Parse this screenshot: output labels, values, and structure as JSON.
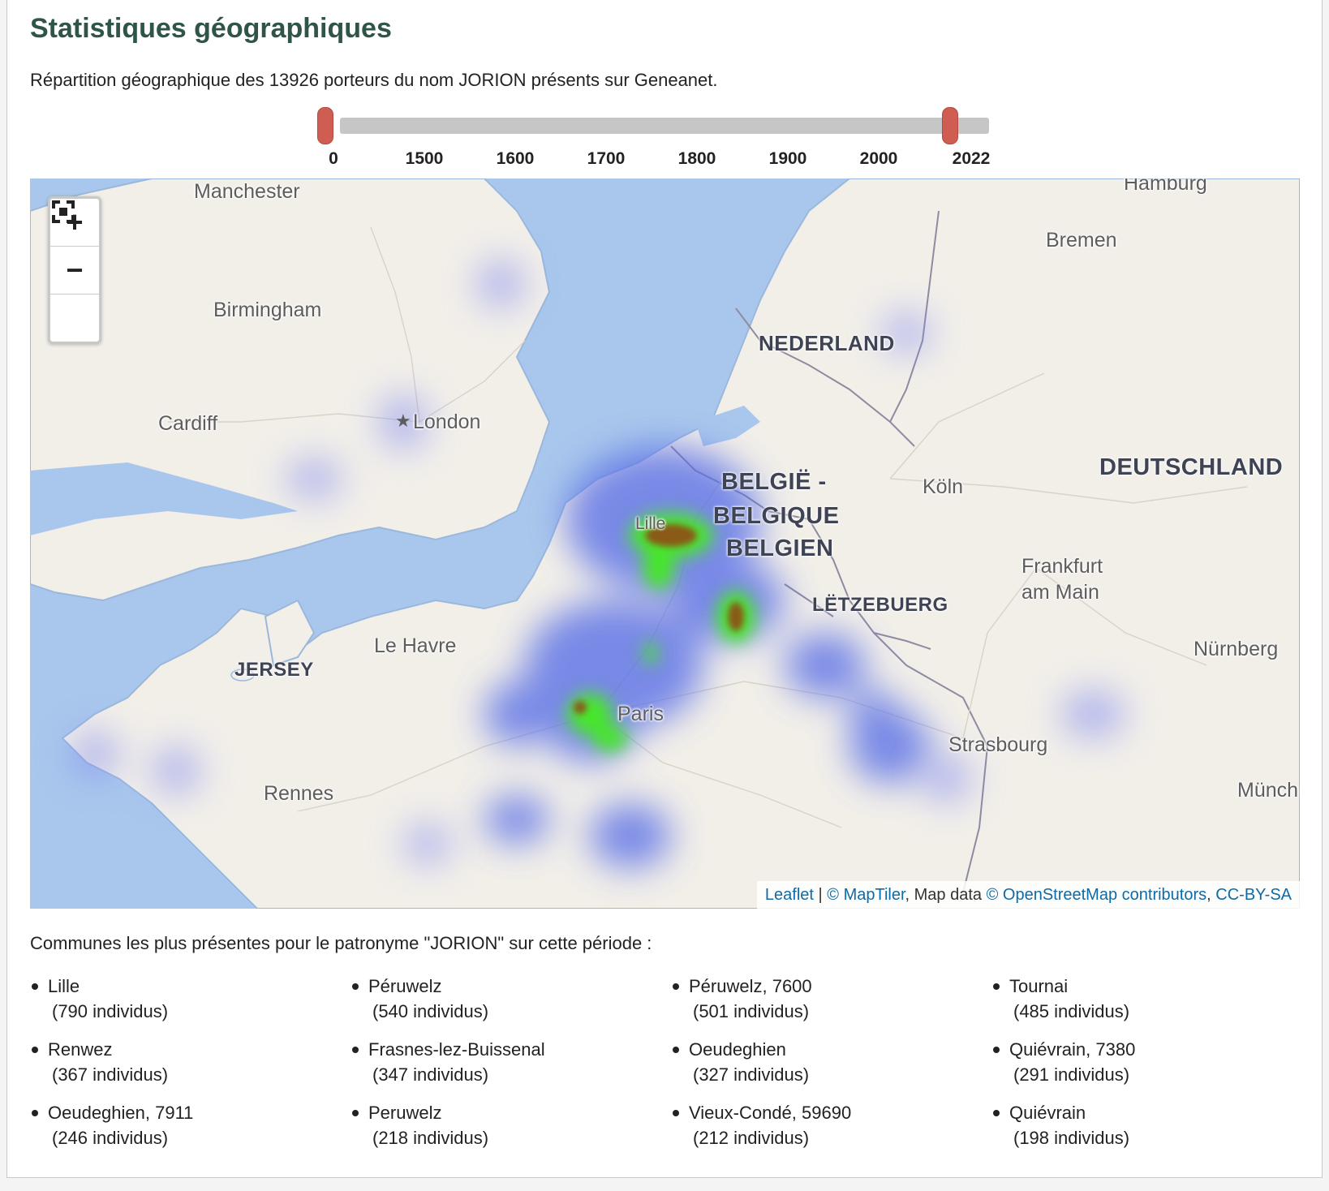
{
  "section": {
    "title": "Statistiques géographiques",
    "subtitle": "Répartition géographique des 13926 porteurs du nom JORION présents sur Geneanet."
  },
  "slider": {
    "ticks": [
      "0",
      "1500",
      "1600",
      "1700",
      "1800",
      "1900",
      "2000",
      "2022"
    ],
    "range_start": "0",
    "range_end": "2022"
  },
  "map": {
    "city_labels": {
      "manchester": "Manchester",
      "hamburg": "Hamburg",
      "bremen": "Bremen",
      "birmingham": "Birmingham",
      "cardiff": "Cardiff",
      "london": "London",
      "koln": "Köln",
      "frankfurt": "Frankfurt am Main",
      "le_havre": "Le Havre",
      "nurnberg": "Nürnberg",
      "paris": "Paris",
      "strasbourg": "Strasbourg",
      "rennes": "Rennes",
      "munchen": "Münch",
      "lille": "Lille"
    },
    "country_labels": {
      "nederland": "NEDERLAND",
      "belgie_1": "BELGIË -",
      "belgie_2": "BELGIQUE",
      "belgie_3": "BELGIEN",
      "deutschland": "DEUTSCHLAND",
      "letzebuerg": "LËTZEBUERG",
      "jersey": "JERSEY"
    },
    "controls": {
      "zoom_in": "+",
      "zoom_out": "−",
      "fullscreen_icon": "fullscreen-icon"
    },
    "attribution": {
      "leaflet": "Leaflet",
      "sep": " | ",
      "maptiler": "© MapTiler",
      "mapdata": ", Map data ",
      "osm": "© OpenStreetMap contributors",
      "comma": ", ",
      "license": "CC-BY-SA"
    },
    "colors": {
      "water": "#a9c7ec",
      "land": "#f2efe9",
      "heat_low": "#5a6fe6",
      "heat_mid": "#46e62b",
      "heat_high": "#8a5a14"
    }
  },
  "communes": {
    "heading": "Communes les plus présentes pour le patronyme \"JORION\" sur cette période :",
    "items": [
      {
        "name": "Lille",
        "count": "(790 individus)"
      },
      {
        "name": "Péruwelz",
        "count": "(540 individus)"
      },
      {
        "name": "Péruwelz, 7600",
        "count": "(501 individus)"
      },
      {
        "name": "Tournai",
        "count": "(485 individus)"
      },
      {
        "name": "Renwez",
        "count": "(367 individus)"
      },
      {
        "name": "Frasnes-lez-Buissenal",
        "count": "(347 individus)"
      },
      {
        "name": "Oeudeghien",
        "count": "(327 individus)"
      },
      {
        "name": "Quiévrain, 7380",
        "count": "(291 individus)"
      },
      {
        "name": "Oeudeghien, 7911",
        "count": "(246 individus)"
      },
      {
        "name": "Peruwelz",
        "count": "(218 individus)"
      },
      {
        "name": "Vieux-Condé, 59690",
        "count": "(212 individus)"
      },
      {
        "name": "Quiévrain",
        "count": "(198 individus)"
      }
    ]
  }
}
